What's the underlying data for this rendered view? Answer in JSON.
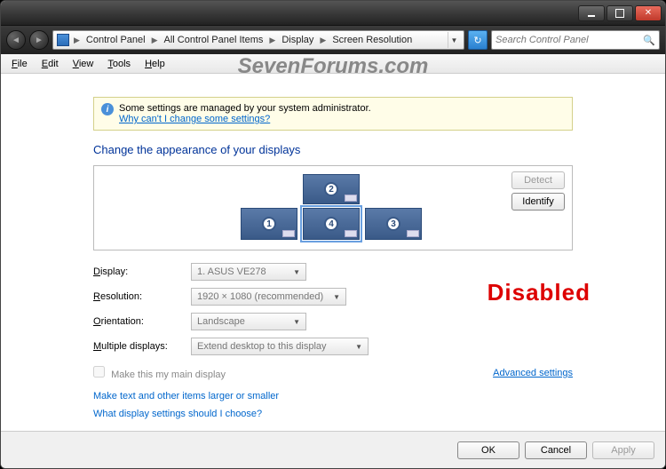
{
  "breadcrumb": {
    "items": [
      "Control Panel",
      "All Control Panel Items",
      "Display",
      "Screen Resolution"
    ]
  },
  "search": {
    "placeholder": "Search Control Panel"
  },
  "menu": {
    "file": "File",
    "edit": "Edit",
    "view": "View",
    "tools": "Tools",
    "help": "Help"
  },
  "watermark": "SevenForums.com",
  "infobox": {
    "text": "Some settings are managed by your system administrator.",
    "link": "Why can't I change some settings?"
  },
  "heading": "Change the appearance of your displays",
  "preview": {
    "detect": "Detect",
    "identify": "Identify",
    "monitors": [
      "1",
      "2",
      "3",
      "4"
    ]
  },
  "form": {
    "display_label": "Display:",
    "display_value": "1. ASUS VE278",
    "resolution_label": "Resolution:",
    "resolution_value": "1920 × 1080 (recommended)",
    "orientation_label": "Orientation:",
    "orientation_value": "Landscape",
    "multiple_label": "Multiple displays:",
    "multiple_value": "Extend desktop to this display"
  },
  "stamp": "Disabled",
  "checkbox_label": "Make this my main display",
  "advanced": "Advanced settings",
  "links": {
    "larger": "Make text and other items larger or smaller",
    "choose": "What display settings should I choose?"
  },
  "footer": {
    "ok": "OK",
    "cancel": "Cancel",
    "apply": "Apply"
  }
}
